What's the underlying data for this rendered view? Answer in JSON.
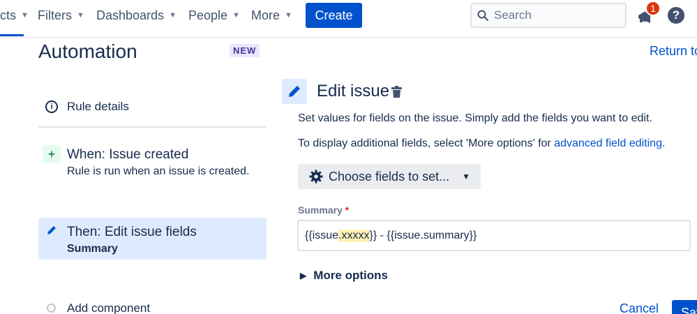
{
  "topnav": {
    "items": [
      {
        "label": "cts"
      },
      {
        "label": "Filters"
      },
      {
        "label": "Dashboards"
      },
      {
        "label": "People"
      },
      {
        "label": "More"
      }
    ],
    "create_label": "Create",
    "search_placeholder": "Search",
    "notification_count": "1",
    "help_label": "?",
    "accent_color": "#0052cc"
  },
  "page": {
    "title": "Automation",
    "badge": "NEW",
    "return_link": "Return to"
  },
  "rule": {
    "details_label": "Rule details",
    "trigger": {
      "title": "When: Issue created",
      "subtitle": "Rule is run when an issue is created."
    },
    "action": {
      "title": "Then: Edit issue fields",
      "subtitle": "Summary"
    },
    "add_component": "Add component"
  },
  "editor": {
    "title": "Edit issue",
    "description": "Set values for fields on the issue. Simply add the fields you want to edit.",
    "additional_prefix": "To display additional fields, select 'More options' for ",
    "additional_link": "advanced field editing",
    "additional_suffix": ".",
    "choose_fields": "Choose fields to set...",
    "summary_label": "Summary",
    "summary_value": {
      "part1": "{{issue",
      "highlighted": ".xxxxx",
      "part2": "}} - {{issue.summary}}"
    },
    "more_options": "More options",
    "cancel": "Cancel",
    "save": "Save"
  }
}
